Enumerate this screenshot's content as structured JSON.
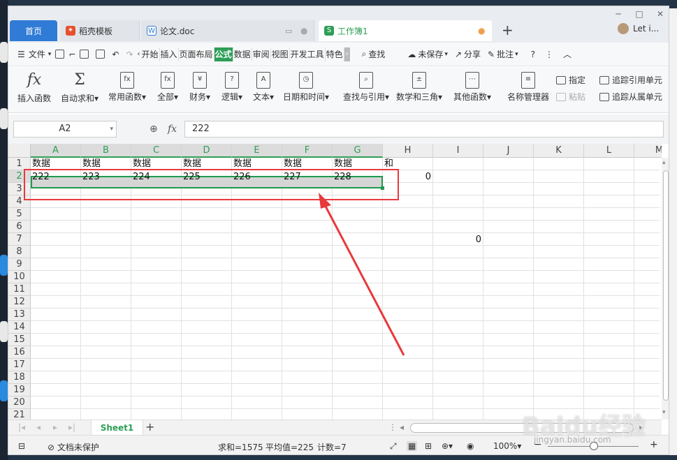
{
  "window": {
    "controls": [
      "─",
      "□",
      "✕"
    ]
  },
  "tabs": [
    {
      "label": "首页",
      "icon": "home"
    },
    {
      "label": "稻壳模板",
      "icon": "docer-icon"
    },
    {
      "label": "论文.doc",
      "icon": "word-icon"
    },
    {
      "label": "工作簿1",
      "icon": "sheet-icon"
    }
  ],
  "user": {
    "name": "Let i..."
  },
  "menu": {
    "file": "文件",
    "tabs": [
      "开始",
      "插入",
      "页面布局",
      "公式",
      "数据",
      "审阅",
      "视图",
      "开发工具",
      "特色"
    ],
    "active_tab": "公式",
    "search": "查找",
    "unsaved": "未保存",
    "share": "分享",
    "comment": "批注"
  },
  "ribbon": {
    "buttons": [
      "插入函数",
      "自动求和",
      "常用函数",
      "全部",
      "财务",
      "逻辑",
      "文本",
      "日期和时间",
      "查找与引用",
      "数学和三角",
      "其他函数",
      "名称管理器"
    ],
    "small": [
      "指定",
      "粘贴",
      "追踪引用单元",
      "追踪从属单元"
    ]
  },
  "formula_bar": {
    "name_box": "A2",
    "fx": "fx",
    "value": "222"
  },
  "grid": {
    "columns": [
      "A",
      "B",
      "C",
      "D",
      "E",
      "F",
      "G",
      "H",
      "I",
      "J",
      "K",
      "L",
      "M"
    ],
    "rows": [
      "1",
      "2",
      "3",
      "4",
      "5",
      "6",
      "7",
      "8",
      "9",
      "10",
      "11",
      "12",
      "13",
      "14",
      "15",
      "16",
      "17",
      "18",
      "19",
      "20",
      "21"
    ],
    "row1": [
      "数据",
      "数据",
      "数据",
      "数据",
      "数据",
      "数据",
      "数据",
      "和"
    ],
    "row2": [
      "222",
      "223",
      "224",
      "225",
      "226",
      "227",
      "228",
      "0"
    ],
    "i7": "0"
  },
  "sheet": {
    "name": "Sheet1"
  },
  "status": {
    "protect": "文档未保护",
    "sum": "求和=1575",
    "avg": "平均值=225",
    "count": "计数=7",
    "zoom": "100%"
  },
  "watermark": {
    "logo": "Baidu经验",
    "url": "jingyan.baidu.com"
  },
  "colors": {
    "accent": "#2e9e56",
    "home_tab": "#2f7bd6",
    "highlight": "#e8393d"
  }
}
